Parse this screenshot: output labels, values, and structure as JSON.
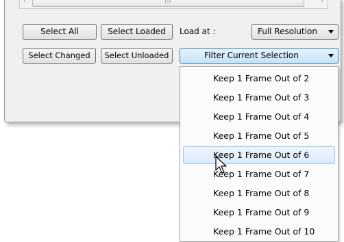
{
  "scrollbar": {
    "thumb_grip": "III"
  },
  "buttons": {
    "select_all": "Select All",
    "select_loaded": "Select Loaded",
    "select_changed": "Select Changed",
    "select_unloaded": "Select Unloaded"
  },
  "load_at": {
    "label": "Load at :",
    "value": "Full Resolution"
  },
  "filter": {
    "value": "Filter Current Selection",
    "options": [
      "Keep 1 Frame Out of 2",
      "Keep 1 Frame Out of 3",
      "Keep 1 Frame Out of 4",
      "Keep 1 Frame Out of 5",
      "Keep 1 Frame Out of 6",
      "Keep 1 Frame Out of 7",
      "Keep 1 Frame Out of 8",
      "Keep 1 Frame Out of 9",
      "Keep 1 Frame Out of 10"
    ],
    "hovered_option": "Keep 1 Frame Out of 6"
  },
  "icons": {
    "cursor": "arrow-cursor-icon",
    "dropdown": "chevron-down-icon"
  }
}
